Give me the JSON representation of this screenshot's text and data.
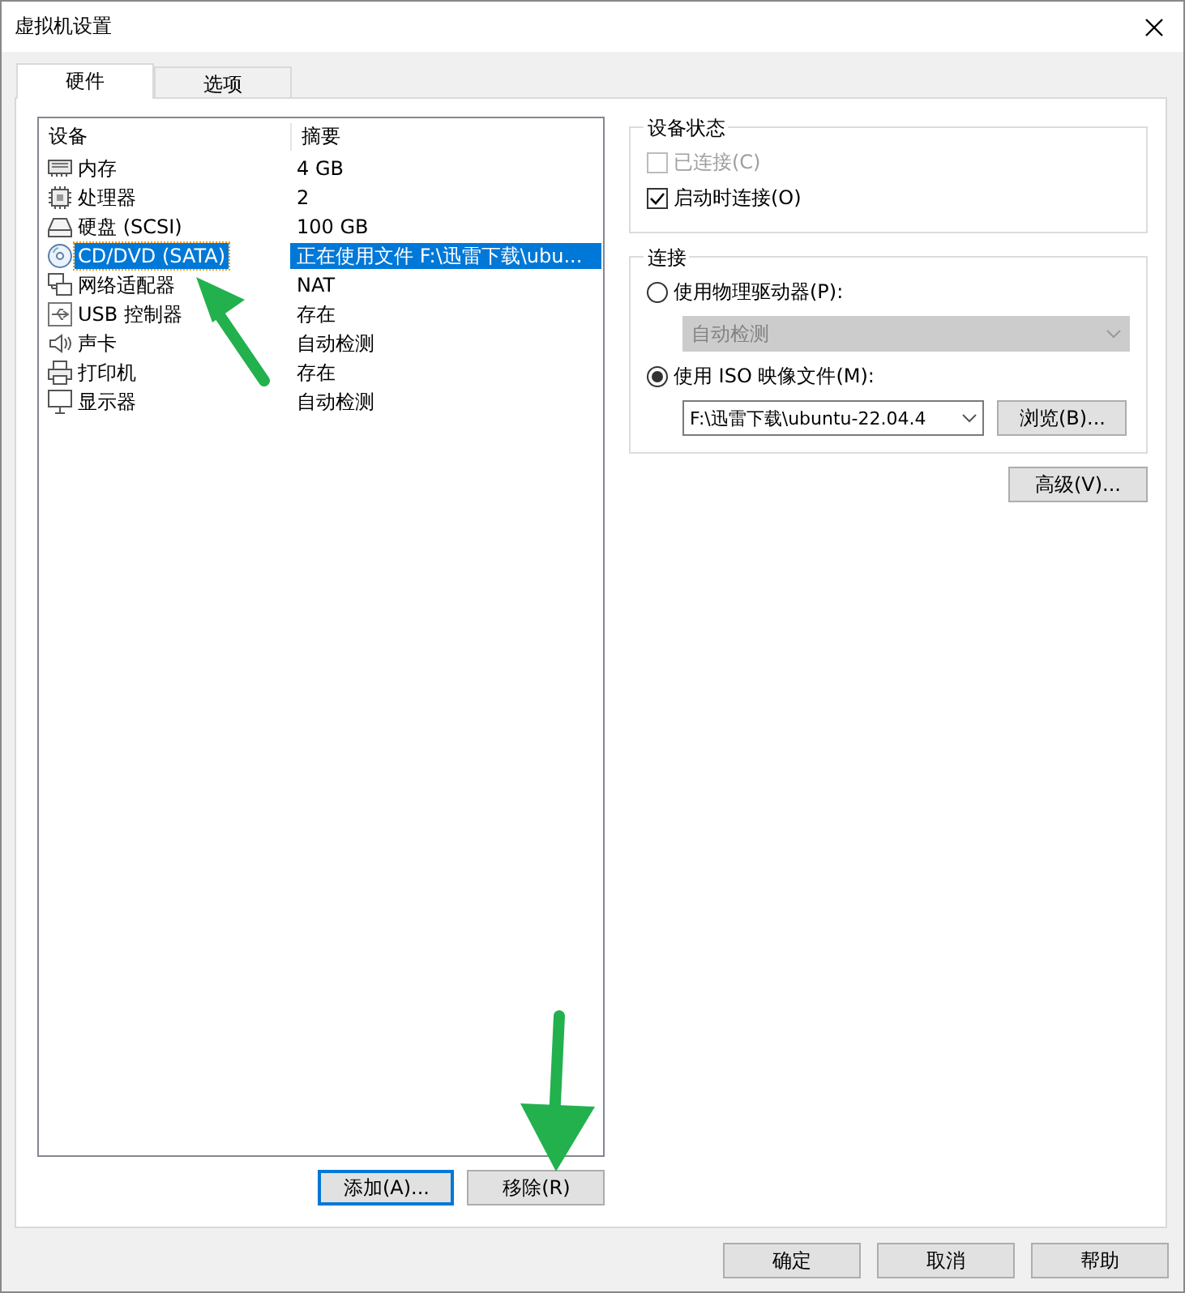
{
  "window": {
    "title": "虚拟机设置"
  },
  "tabs": [
    {
      "label": "硬件",
      "selected": true
    },
    {
      "label": "选项",
      "selected": false
    }
  ],
  "device_list": {
    "columns": [
      "设备",
      "摘要"
    ],
    "rows": [
      {
        "kind": "memory",
        "device": "内存",
        "summary": "4 GB",
        "selected": false
      },
      {
        "kind": "cpu",
        "device": "处理器",
        "summary": "2",
        "selected": false
      },
      {
        "kind": "disk",
        "device": "硬盘 (SCSI)",
        "summary": "100 GB",
        "selected": false
      },
      {
        "kind": "cd",
        "device": "CD/DVD (SATA)",
        "summary": "正在使用文件 F:\\迅雷下载\\ubu...",
        "selected": true
      },
      {
        "kind": "network",
        "device": "网络适配器",
        "summary": "NAT",
        "selected": false
      },
      {
        "kind": "usb",
        "device": "USB 控制器",
        "summary": "存在",
        "selected": false
      },
      {
        "kind": "sound",
        "device": "声卡",
        "summary": "自动检测",
        "selected": false
      },
      {
        "kind": "printer",
        "device": "打印机",
        "summary": "存在",
        "selected": false
      },
      {
        "kind": "monitor",
        "device": "显示器",
        "summary": "自动检测",
        "selected": false
      }
    ]
  },
  "list_buttons": [
    {
      "label": "添加(A)...",
      "focused": true
    },
    {
      "label": "移除(R)",
      "focused": false
    }
  ],
  "device_status": {
    "title": "设备状态",
    "options": [
      {
        "label": "已连接(C)",
        "checked": false,
        "disabled": true
      },
      {
        "label": "启动时连接(O)",
        "checked": true,
        "disabled": false
      }
    ]
  },
  "connection": {
    "title": "连接",
    "physical": {
      "label": "使用物理驱动器(P):",
      "selected": false
    },
    "physical_drive": {
      "value": "自动检测",
      "disabled": true
    },
    "iso": {
      "label": "使用 ISO 映像文件(M):",
      "selected": true
    },
    "iso_path": {
      "value": "F:\\迅雷下载\\ubuntu-22.04.4"
    },
    "browse_button": "浏览(B)..."
  },
  "advanced_button": "高级(V)...",
  "dialog_buttons": [
    "确定",
    "取消",
    "帮助"
  ]
}
